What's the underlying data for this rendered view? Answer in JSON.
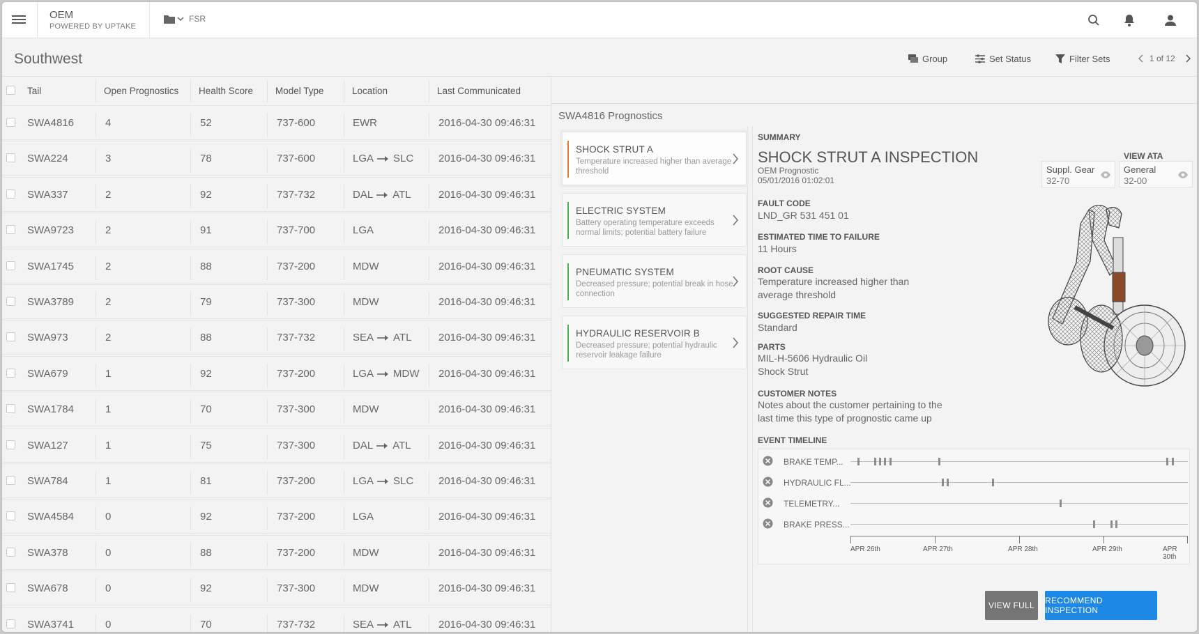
{
  "app": {
    "title": "OEM",
    "subtitle": "POWERED BY UPTAKE",
    "folder_label": "FSR"
  },
  "page": {
    "title": "Southwest"
  },
  "toolbar": {
    "group": "Group",
    "set_status": "Set Status",
    "filter_sets": "Filter Sets",
    "pager": "1 of 12"
  },
  "table": {
    "headers": [
      "Tail",
      "Open Prognostics",
      "Health Score",
      "Model Type",
      "Location",
      "Last Communicated"
    ],
    "rows": [
      {
        "tail": "SWA4816",
        "open": "4",
        "health": "52",
        "model": "737-600",
        "loc_from": "EWR",
        "loc_to": "",
        "last": "2016-04-30 09:46:31"
      },
      {
        "tail": "SWA224",
        "open": "3",
        "health": "78",
        "model": "737-600",
        "loc_from": "LGA",
        "loc_to": "SLC",
        "last": "2016-04-30 09:46:31"
      },
      {
        "tail": "SWA337",
        "open": "2",
        "health": "92",
        "model": "737-732",
        "loc_from": "DAL",
        "loc_to": "ATL",
        "last": "2016-04-30 09:46:31"
      },
      {
        "tail": "SWA9723",
        "open": "2",
        "health": "91",
        "model": "737-700",
        "loc_from": "LGA",
        "loc_to": "",
        "last": "2016-04-30 09:46:31"
      },
      {
        "tail": "SWA1745",
        "open": "2",
        "health": "88",
        "model": "737-200",
        "loc_from": "MDW",
        "loc_to": "",
        "last": "2016-04-30 09:46:31"
      },
      {
        "tail": "SWA3789",
        "open": "2",
        "health": "79",
        "model": "737-300",
        "loc_from": "MDW",
        "loc_to": "",
        "last": "2016-04-30 09:46:31"
      },
      {
        "tail": "SWA973",
        "open": "2",
        "health": "88",
        "model": "737-732",
        "loc_from": "SEA",
        "loc_to": "ATL",
        "last": "2016-04-30 09:46:31"
      },
      {
        "tail": "SWA679",
        "open": "1",
        "health": "92",
        "model": "737-200",
        "loc_from": "LGA",
        "loc_to": "MDW",
        "last": "2016-04-30 09:46:31"
      },
      {
        "tail": "SWA1784",
        "open": "1",
        "health": "70",
        "model": "737-300",
        "loc_from": "MDW",
        "loc_to": "",
        "last": "2016-04-30 09:46:31"
      },
      {
        "tail": "SWA127",
        "open": "1",
        "health": "75",
        "model": "737-300",
        "loc_from": "DAL",
        "loc_to": "ATL",
        "last": "2016-04-30 09:46:31"
      },
      {
        "tail": "SWA784",
        "open": "1",
        "health": "81",
        "model": "737-200",
        "loc_from": "LGA",
        "loc_to": "SLC",
        "last": "2016-04-30 09:46:31"
      },
      {
        "tail": "SWA4584",
        "open": "0",
        "health": "92",
        "model": "737-200",
        "loc_from": "LGA",
        "loc_to": "",
        "last": "2016-04-30 09:46:31"
      },
      {
        "tail": "SWA378",
        "open": "0",
        "health": "88",
        "model": "737-200",
        "loc_from": "MDW",
        "loc_to": "",
        "last": "2016-04-30 09:46:31"
      },
      {
        "tail": "SWA678",
        "open": "0",
        "health": "92",
        "model": "737-300",
        "loc_from": "MDW",
        "loc_to": "",
        "last": "2016-04-30 09:46:31"
      },
      {
        "tail": "SWA3741",
        "open": "0",
        "health": "70",
        "model": "737-732",
        "loc_from": "SEA",
        "loc_to": "ATL",
        "last": "2016-04-30 09:46:31"
      }
    ]
  },
  "panel": {
    "title": "SWA4816 Prognostics",
    "prognostics": [
      {
        "title": "SHOCK STRUT A",
        "desc": "Temperature increased higher than average threshold",
        "color": "#e07b3c"
      },
      {
        "title": "ELECTRIC SYSTEM",
        "desc": "Battery operating temperature exceeds normal limits; potential battery failure",
        "color": "#4caf50"
      },
      {
        "title": "PNEUMATIC SYSTEM",
        "desc": "Decreased pressure; potential break in hose connection",
        "color": "#4caf50"
      },
      {
        "title": "HYDRAULIC RESERVOIR B",
        "desc": "Decreased pressure; potential hydraulic reservoir leakage failure",
        "color": "#4caf50"
      }
    ]
  },
  "detail": {
    "summary_label": "SUMMARY",
    "title": "SHOCK STRUT A INSPECTION",
    "source": "OEM Prognostic",
    "datetime": "05/01/2016 01:02:01",
    "view_ata_label": "VIEW ATA CODES",
    "ata": [
      {
        "name": "Suppl. Gear",
        "code": "32-70"
      },
      {
        "name": "General",
        "code": "32-00"
      }
    ],
    "fault_code_label": "FAULT CODE",
    "fault_code": "LND_GR 531 451 01",
    "ettf_label": "ESTIMATED TIME TO FAILURE",
    "ettf": "11 Hours",
    "root_cause_label": "ROOT CAUSE",
    "root_cause": "Temperature increased higher than average threshold",
    "repair_label": "SUGGESTED REPAIR TIME",
    "repair": "Standard",
    "parts_label": "PARTS",
    "parts": [
      "MIL-H-5606 Hydraulic Oil",
      "Shock Strut"
    ],
    "notes_label": "CUSTOMER NOTES",
    "notes": "Notes about the customer pertaining to the last time this type of prognostic came up",
    "timeline_label": "EVENT TIMELINE",
    "timeline": [
      {
        "name": "BRAKE TEMP...",
        "events": [
          0.02,
          0.07,
          0.085,
          0.1,
          0.115,
          0.26,
          0.935,
          0.952
        ]
      },
      {
        "name": "HYDRAULIC FL...",
        "events": [
          0.27,
          0.285,
          0.42
        ]
      },
      {
        "name": "TELEMETRY...",
        "events": [
          0.62
        ]
      },
      {
        "name": "BRAKE PRESS...",
        "events": [
          0.72,
          0.77,
          0.785
        ]
      }
    ],
    "axis_labels": [
      "APR 26th",
      "APR 27th",
      "APR 28th",
      "APR 29th",
      "APR 30th"
    ],
    "view_full": "VIEW FULL",
    "recommend": "RECOMMEND INSPECTION",
    "colors": {
      "accent": "#1e88e5",
      "secondary_button": "#757575"
    }
  }
}
